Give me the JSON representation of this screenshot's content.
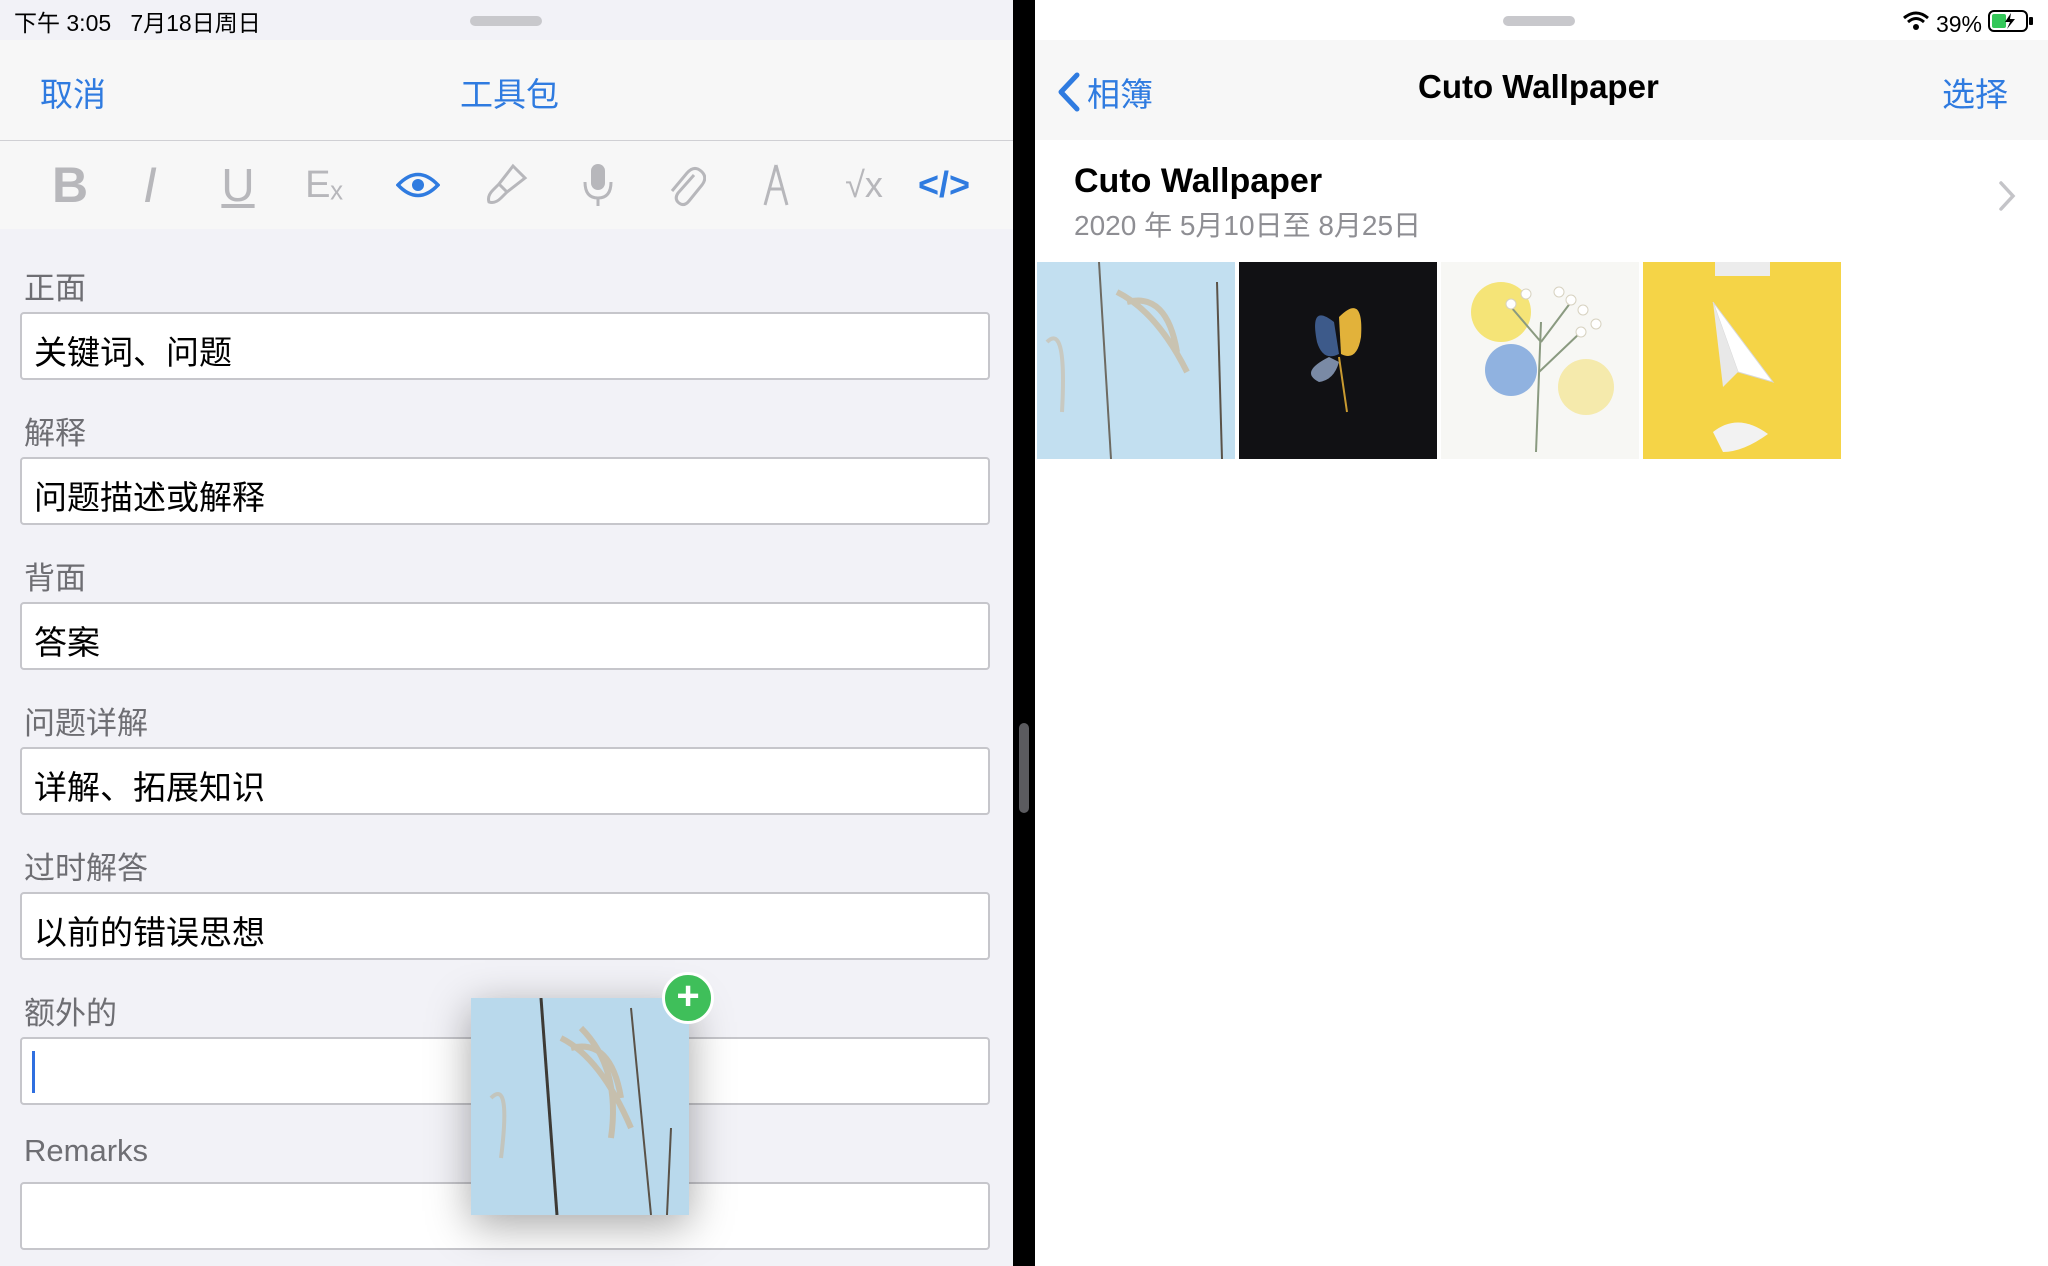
{
  "left": {
    "status": {
      "time": "下午 3:05",
      "date": "7月18日周日"
    },
    "nav": {
      "cancel": "取消",
      "title": "工具包"
    },
    "toolbar": [
      {
        "name": "bold-icon",
        "glyph": "B"
      },
      {
        "name": "italic-icon",
        "glyph": "I"
      },
      {
        "name": "underline-icon",
        "glyph": "U"
      },
      {
        "name": "clear-format-icon",
        "glyph": "Eₓ"
      },
      {
        "name": "eye-icon",
        "glyph": ""
      },
      {
        "name": "brush-icon",
        "glyph": ""
      },
      {
        "name": "microphone-icon",
        "glyph": ""
      },
      {
        "name": "paperclip-icon",
        "glyph": ""
      },
      {
        "name": "pen-icon",
        "glyph": ""
      },
      {
        "name": "math-icon",
        "glyph": "√x"
      },
      {
        "name": "code-icon",
        "glyph": "</>"
      }
    ],
    "fields": [
      {
        "label": "正面",
        "value": "关键词、问题"
      },
      {
        "label": "解释",
        "value": "问题描述或解释"
      },
      {
        "label": "背面",
        "value": "答案"
      },
      {
        "label": "问题详解",
        "value": "详解、拓展知识"
      },
      {
        "label": "过时解答",
        "value": "以前的错误思想"
      },
      {
        "label": "额外的",
        "value": ""
      },
      {
        "label": "Remarks",
        "value": ""
      }
    ],
    "drag_badge": "+"
  },
  "right": {
    "status": {
      "battery": "39%"
    },
    "nav": {
      "back": "相簿",
      "title": "Cuto Wallpaper",
      "select": "选择"
    },
    "album": {
      "title": "Cuto Wallpaper",
      "date_range": "2020 年 5月10日至 8月25日"
    },
    "photos": [
      "reed-photo",
      "butterfly-photo",
      "flowers-photo",
      "paper-plane-photo"
    ]
  },
  "colors": {
    "accent": "#2f7be0",
    "add_badge": "#3fbf5a",
    "photo_yellow": "#f5d447",
    "photo_black": "#111114"
  }
}
